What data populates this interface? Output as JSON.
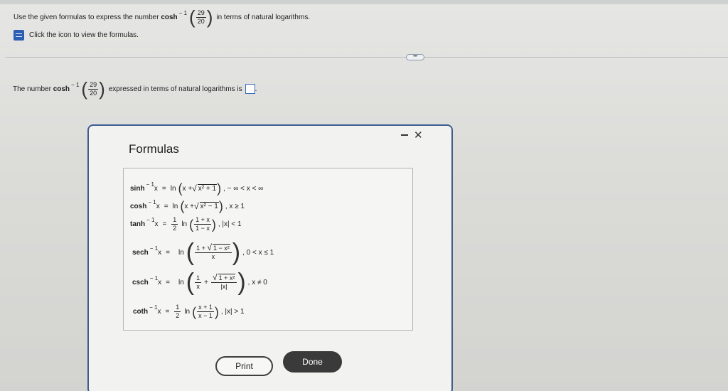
{
  "question": {
    "prefix": "Use the given formulas to express the number",
    "fn": "cosh",
    "exp": "− 1",
    "num": "29",
    "den": "20",
    "suffix": "in terms of natural logarithms."
  },
  "hint": {
    "icon": "document-icon",
    "text": "Click the icon to view the formulas."
  },
  "more_label": "•••",
  "answer": {
    "prefix": "The number",
    "fn": "cosh",
    "exp": "− 1",
    "num": "29",
    "den": "20",
    "suffix": "expressed in terms of natural logarithms is",
    "end": "."
  },
  "dialog": {
    "title": "Formulas",
    "minimize_icon": "minimize-icon",
    "close_label": "✕",
    "print_label": "Print",
    "done_label": "Done"
  },
  "formulas": {
    "sinh": {
      "fn": "sinh",
      "exp": "− 1",
      "var": "x",
      "eq": "=",
      "ln": "ln",
      "lp": "(",
      "rp": ")",
      "pre": "x +",
      "radicand": "x² + 1",
      "cond": ", − ∞ < x < ∞"
    },
    "cosh": {
      "fn": "cosh",
      "exp": "− 1",
      "var": "x",
      "eq": "=",
      "ln": "ln",
      "lp": "(",
      "rp": ")",
      "pre": "x +",
      "radicand": "x² − 1",
      "cond": ", x ≥ 1"
    },
    "tanh": {
      "fn": "tanh",
      "exp": "− 1",
      "var": "x",
      "eq": "=",
      "half_num": "1",
      "half_den": "2",
      "ln": "ln",
      "lp": "(",
      "rp": ")",
      "num": "1 + x",
      "den": "1 − x",
      "cond": ", |x| < 1"
    },
    "sech": {
      "fn": "sech",
      "exp": "− 1",
      "var": "x",
      "eq": "=",
      "ln": "ln",
      "lp": "(",
      "rp": ")",
      "num_pre": "1 +",
      "radicand": "1 − x²",
      "den": "x",
      "cond": ", 0 < x ≤ 1"
    },
    "csch": {
      "fn": "csch",
      "exp": "− 1",
      "var": "x",
      "eq": "=",
      "ln": "ln",
      "lp": "(",
      "rp": ")",
      "one": "1",
      "xden": "x",
      "plus": "+",
      "radicand": "1 + x²",
      "absden": "|x|",
      "cond": ", x ≠ 0"
    },
    "coth": {
      "fn": "coth",
      "exp": "− 1",
      "var": "x",
      "eq": "=",
      "half_num": "1",
      "half_den": "2",
      "ln": "ln",
      "lp": "(",
      "rp": ")",
      "num": "x + 1",
      "den": "x − 1",
      "cond": ", |x| > 1"
    }
  }
}
